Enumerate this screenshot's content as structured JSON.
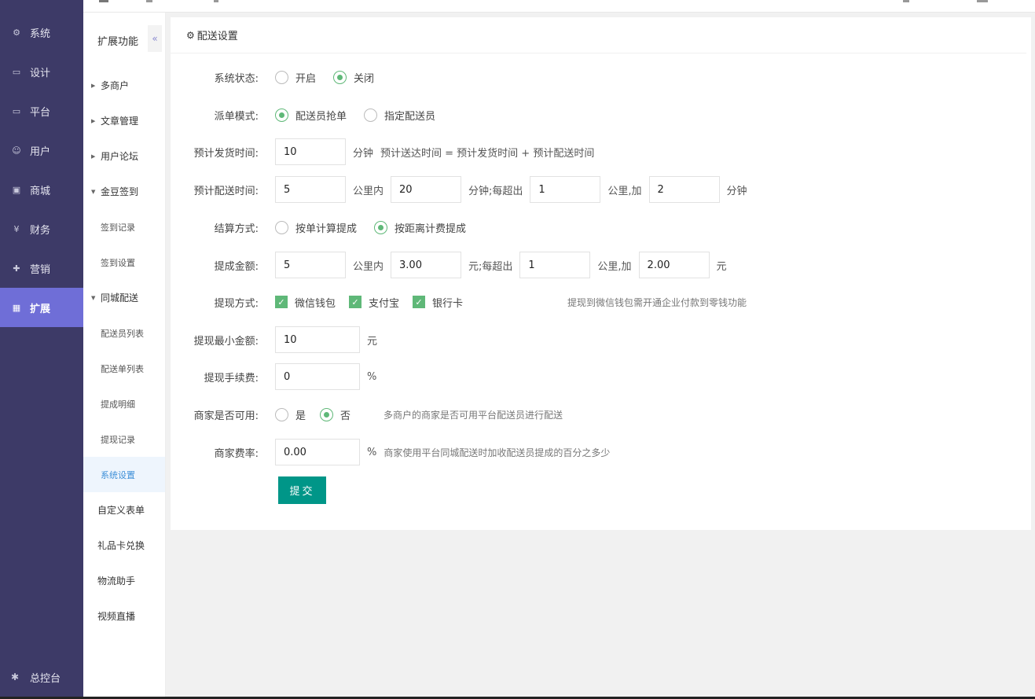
{
  "nav": {
    "items": [
      {
        "label": "系统",
        "icon": "gear-icon"
      },
      {
        "label": "设计",
        "icon": "monitor-icon"
      },
      {
        "label": "平台",
        "icon": "monitor-icon"
      },
      {
        "label": "用户",
        "icon": "user-icon"
      },
      {
        "label": "商城",
        "icon": "shop-icon"
      },
      {
        "label": "财务",
        "icon": "yen-icon"
      },
      {
        "label": "营销",
        "icon": "gift-icon"
      },
      {
        "label": "扩展",
        "icon": "grid-icon"
      }
    ],
    "active": "扩展",
    "bottom_label": "总控台",
    "accent": "#6f6ed7",
    "background": "#3d3a67"
  },
  "submenu": {
    "title": "扩展功能",
    "collapse_glyph": "«",
    "items": [
      {
        "label": "多商户",
        "kind": "group",
        "expanded": false
      },
      {
        "label": "文章管理",
        "kind": "group",
        "expanded": false
      },
      {
        "label": "用户论坛",
        "kind": "group",
        "expanded": false
      },
      {
        "label": "金豆签到",
        "kind": "group",
        "expanded": true
      },
      {
        "label": "签到记录",
        "kind": "child"
      },
      {
        "label": "签到设置",
        "kind": "child"
      },
      {
        "label": "同城配送",
        "kind": "group",
        "expanded": true
      },
      {
        "label": "配送员列表",
        "kind": "child"
      },
      {
        "label": "配送单列表",
        "kind": "child"
      },
      {
        "label": "提成明细",
        "kind": "child"
      },
      {
        "label": "提现记录",
        "kind": "child"
      },
      {
        "label": "系统设置",
        "kind": "child",
        "active": true
      },
      {
        "label": "自定义表单",
        "kind": "plain"
      },
      {
        "label": "礼品卡兑换",
        "kind": "plain"
      },
      {
        "label": "物流助手",
        "kind": "plain"
      },
      {
        "label": "视频直播",
        "kind": "plain"
      }
    ]
  },
  "panel": {
    "title": "配送设置",
    "status": {
      "label": "系统状态:",
      "options": [
        "开启",
        "关闭"
      ],
      "selected": "关闭"
    },
    "dispatch": {
      "label": "派单模式:",
      "options": [
        "配送员抢单",
        "指定配送员"
      ],
      "selected": "配送员抢单"
    },
    "ship_time": {
      "label": "预计发货时间:",
      "value": "10",
      "unit": "分钟",
      "note": "预计送达时间 = 预计发货时间 + 预计配送时间"
    },
    "delivery_time": {
      "label": "预计配送时间:",
      "km": "5",
      "t1": "公里内",
      "minutes": "20",
      "t2": "分钟;每超出",
      "extra_km": "1",
      "t3": "公里,加",
      "extra_min": "2",
      "t4": "分钟"
    },
    "settle": {
      "label": "结算方式:",
      "options": [
        "按单计算提成",
        "按距离计费提成"
      ],
      "selected": "按距离计费提成"
    },
    "commission": {
      "label": "提成金额:",
      "km": "5",
      "t1": "公里内",
      "amount": "3.00",
      "t2": "元;每超出",
      "extra_km": "1",
      "t3": "公里,加",
      "extra_amount": "2.00",
      "t4": "元"
    },
    "withdraw": {
      "label": "提现方式:",
      "options": [
        "微信钱包",
        "支付宝",
        "银行卡"
      ],
      "checked": [
        true,
        true,
        true
      ],
      "hint": "提现到微信钱包需开通企业付款到零钱功能"
    },
    "min_withdraw": {
      "label": "提现最小金额:",
      "value": "10",
      "unit": "元"
    },
    "fee": {
      "label": "提现手续费:",
      "value": "0",
      "unit": "%"
    },
    "merchant_use": {
      "label": "商家是否可用:",
      "options": [
        "是",
        "否"
      ],
      "selected": "否",
      "hint": "多商户的商家是否可用平台配送员进行配送"
    },
    "merchant_rate": {
      "label": "商家费率:",
      "value": "0.00",
      "unit": "%",
      "hint": "商家使用平台同城配送时加收配送员提成的百分之多少"
    },
    "submit_label": "提交",
    "accent_green": "#5fb878",
    "submit_color": "#009688"
  }
}
